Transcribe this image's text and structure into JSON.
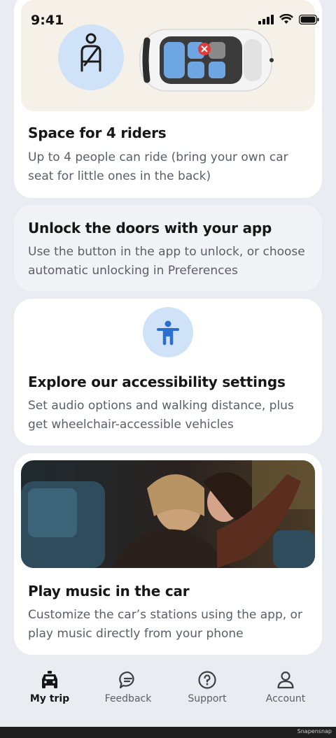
{
  "status": {
    "time": "9:41"
  },
  "cards": [
    {
      "title": "Space for 4 riders",
      "body": "Up to 4 people can ride (bring your own car seat for little ones in the back)"
    },
    {
      "title": "Unlock the doors with your app",
      "body": "Use the button in the app to unlock, or choose automatic unlocking in Preferences"
    },
    {
      "title": "Explore our accessibility settings",
      "body": "Set audio options and walking distance, plus get wheelchair-accessible vehicles"
    },
    {
      "title": "Play music in the car",
      "body": "Customize the car’s stations using the app, or play music directly from your phone"
    }
  ],
  "nav": [
    {
      "label": "My trip",
      "icon": "car-icon",
      "active": true
    },
    {
      "label": "Feedback",
      "icon": "chat-bubble-icon",
      "active": false
    },
    {
      "label": "Support",
      "icon": "question-circle-icon",
      "active": false
    },
    {
      "label": "Account",
      "icon": "person-icon",
      "active": false
    }
  ],
  "watermark": "Snapensnap",
  "colors": {
    "background": "#e9edf2",
    "card": "#ffffff",
    "accent_circle": "#cfe2f7",
    "accent_icon": "#2a6fd0",
    "seat_blue": "#6ea6e4",
    "warning_red": "#e23b3b"
  }
}
